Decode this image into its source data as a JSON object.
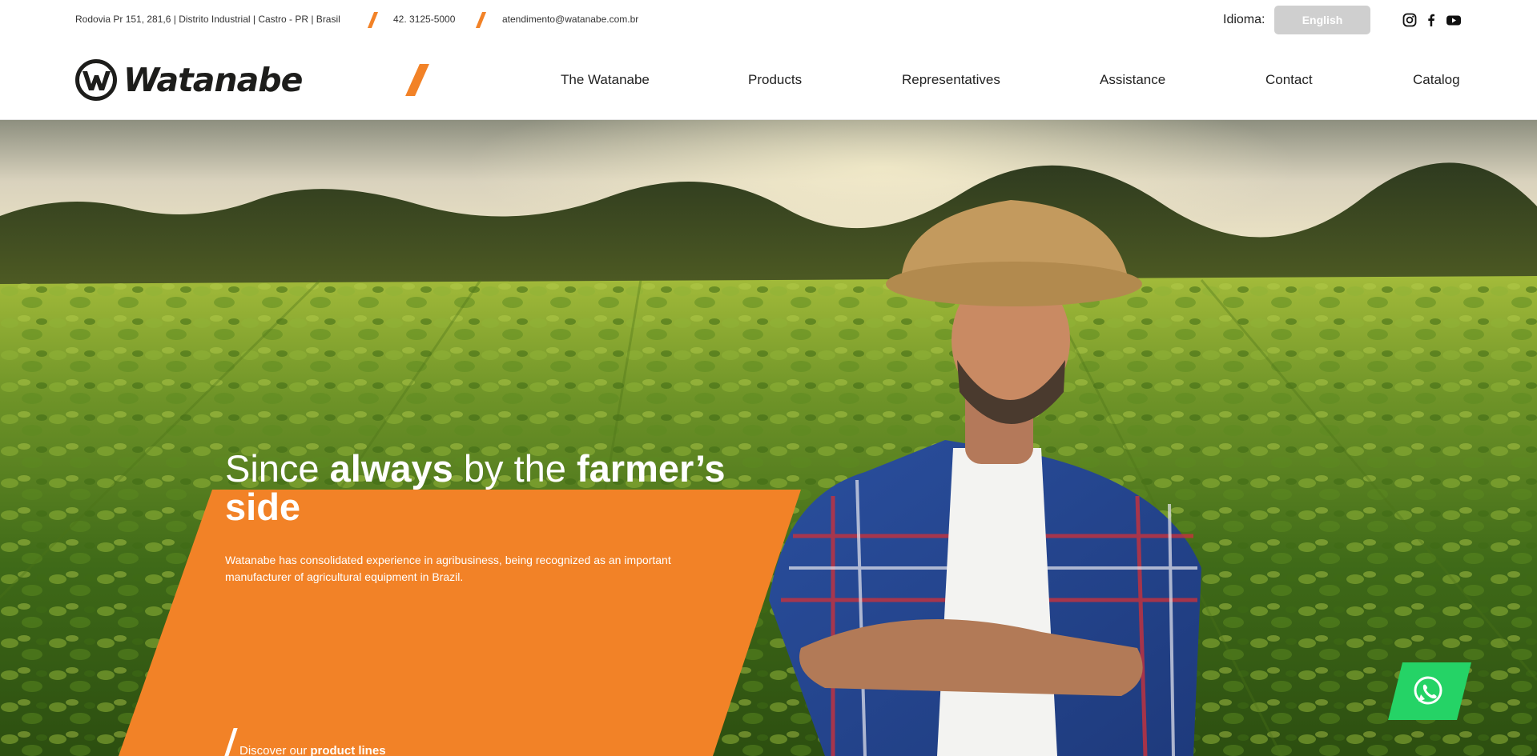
{
  "topbar": {
    "address": "Rodovia Pr 151, 281,6 | Distrito Industrial | Castro - PR | Brasil",
    "phone": "42. 3125-5000",
    "email": "atendimento@watanabe.com.br",
    "language_label": "Idioma:",
    "language_value": "English",
    "social_icons": [
      "instagram-icon",
      "facebook-icon",
      "youtube-icon"
    ]
  },
  "header": {
    "logo_text": "Watanabe",
    "nav": [
      "The Watanabe",
      "Products",
      "Representatives",
      "Assistance",
      "Contact",
      "Catalog"
    ]
  },
  "hero": {
    "title_parts": [
      "Since ",
      "always",
      " by the ",
      "farmer’s",
      "side"
    ],
    "description": "Watanabe has consolidated experience in agribusiness, being recognized as an important manufacturer of agricultural equipment in Brazil.",
    "cta_prefix": "Discover our ",
    "cta_bold": "product lines"
  },
  "colors": {
    "accent": "#f28227",
    "whatsapp": "#25d366",
    "text": "#1d1d1b"
  }
}
